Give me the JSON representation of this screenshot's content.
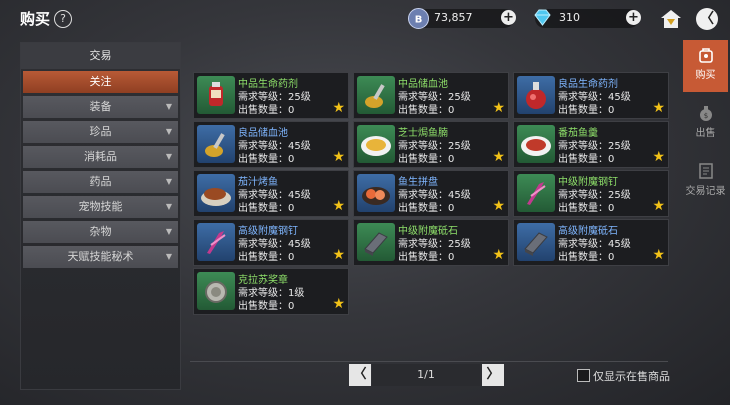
{
  "header": {
    "title": "购买",
    "help": "?",
    "coins": "73,857",
    "gems": "310",
    "plus": "+",
    "back": "〈"
  },
  "sidebar": {
    "header": "交易",
    "items": [
      {
        "label": "关注",
        "active": true,
        "dropdown": false
      },
      {
        "label": "装备",
        "dropdown": true
      },
      {
        "label": "珍品",
        "dropdown": true
      },
      {
        "label": "消耗品",
        "dropdown": true
      },
      {
        "label": "药品",
        "dropdown": true
      },
      {
        "label": "宠物技能",
        "dropdown": true
      },
      {
        "label": "杂物",
        "dropdown": true
      },
      {
        "label": "天赋技能秘术",
        "dropdown": true
      }
    ],
    "dropdown_glyph": "▼"
  },
  "items": [
    {
      "name": "中品生命药剂",
      "req": "需求等级：25级",
      "sold": "出售数量：0",
      "bg": "green",
      "color": "#8ee06a"
    },
    {
      "name": "中品储血池",
      "req": "需求等级：25级",
      "sold": "出售数量：0",
      "bg": "green",
      "color": "#8ee06a"
    },
    {
      "name": "良品生命药剂",
      "req": "需求等级：45级",
      "sold": "出售数量：0",
      "bg": "blue",
      "color": "#7fb6ff"
    },
    {
      "name": "良品储血池",
      "req": "需求等级：45级",
      "sold": "出售数量：0",
      "bg": "blue",
      "color": "#7fb6ff"
    },
    {
      "name": "芝士焗鱼腩",
      "req": "需求等级：25级",
      "sold": "出售数量：0",
      "bg": "green",
      "color": "#8ee06a"
    },
    {
      "name": "番茄鱼羹",
      "req": "需求等级：25级",
      "sold": "出售数量：0",
      "bg": "green",
      "color": "#8ee06a"
    },
    {
      "name": "茄汁烤鱼",
      "req": "需求等级：45级",
      "sold": "出售数量：0",
      "bg": "blue",
      "color": "#7fb6ff"
    },
    {
      "name": "鱼生拼盘",
      "req": "需求等级：45级",
      "sold": "出售数量：0",
      "bg": "blue",
      "color": "#7fb6ff"
    },
    {
      "name": "中级附魔钢钉",
      "req": "需求等级：25级",
      "sold": "出售数量：0",
      "bg": "green",
      "color": "#8ee06a"
    },
    {
      "name": "高级附魔钢钉",
      "req": "需求等级：45级",
      "sold": "出售数量：0",
      "bg": "blue",
      "color": "#7fb6ff"
    },
    {
      "name": "中级附魔砥石",
      "req": "需求等级：25级",
      "sold": "出售数量：0",
      "bg": "green",
      "color": "#8ee06a"
    },
    {
      "name": "高级附魔砥石",
      "req": "需求等级：45级",
      "sold": "出售数量：0",
      "bg": "blue",
      "color": "#7fb6ff"
    },
    {
      "name": "克拉苏奖章",
      "req": "需求等级：1级",
      "sold": "出售数量：0",
      "bg": "green",
      "color": "#8ee06a"
    }
  ],
  "star_glyph": "★",
  "pagination": {
    "prev": "〈",
    "next": "〉",
    "text": "1/1"
  },
  "filter": {
    "label": "仅显示在售商品",
    "checked": false
  },
  "right_tabs": [
    {
      "label": "购买",
      "icon": "shop-bag-icon",
      "active": true
    },
    {
      "label": "出售",
      "icon": "money-bag-icon",
      "active": false
    },
    {
      "label": "交易记录",
      "icon": "record-icon",
      "active": false
    }
  ],
  "colors": {
    "accent": "#c75a35",
    "star": "#f2c218",
    "green_item": "#8ee06a",
    "blue_item": "#7fb6ff"
  }
}
